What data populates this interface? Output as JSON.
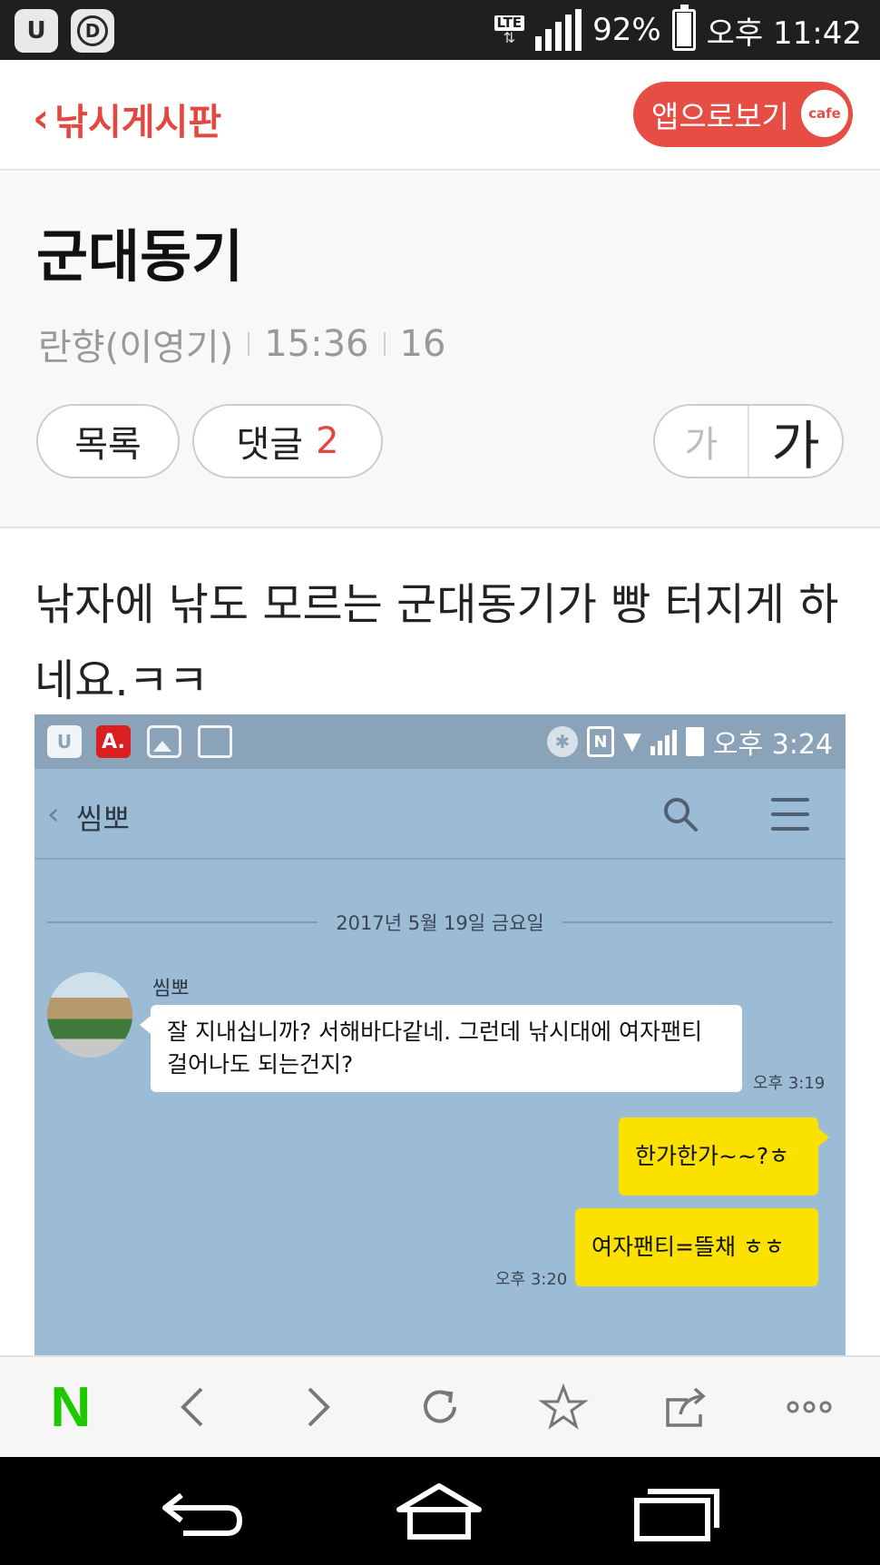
{
  "status_bar": {
    "app_icons": [
      "U",
      "D"
    ],
    "network": "LTE",
    "battery": "92%",
    "battery_level": 0.92,
    "time": "오후 11:42"
  },
  "cafe_header": {
    "back_label": "낚시게시판",
    "app_button": "앱으로보기",
    "cafe_badge": "cafe",
    "accent_color": "#e4473f"
  },
  "article": {
    "title": "군대동기",
    "author": "란향(이영기)",
    "time": "15:36",
    "views": "16",
    "list_button": "목록",
    "comment_label": "댓글",
    "comment_count": "2",
    "font_small": "가",
    "font_large": "가",
    "body_text": "낚자에 낚도 모르는 군대동기가 빵 터지게 하네요.ㅋㅋ"
  },
  "embedded_screenshot": {
    "status_bar": {
      "app_a_icon": "A.",
      "app_u_icon": "U",
      "nfc": "N",
      "time": "오후 3:24"
    },
    "chat_title": "씸뽀",
    "date_divider": "2017년 5월 19일 금요일",
    "messages": [
      {
        "sender": "씸뽀",
        "text": "잘 지내십니까? 서해바다같네. 그런데 낚시대에 여자팬티 걸어나도 되는건지?",
        "time": "오후 3:19"
      },
      {
        "text": "한가한가~~?ㅎ"
      },
      {
        "text": "여자팬티=뜰채 ㅎㅎ",
        "time": "오후 3:20"
      }
    ],
    "bubble_colors": {
      "incoming": "#ffffff",
      "outgoing": "#fae100",
      "background": "#9cbcd6"
    }
  },
  "toolbar": {
    "naver_label": "N",
    "icons": [
      "naver-icon",
      "back-arrow-icon",
      "forward-arrow-icon",
      "refresh-icon",
      "star-icon",
      "share-icon",
      "more-icon"
    ]
  },
  "nav_bar": {
    "icons": [
      "back-icon",
      "home-icon",
      "recent-apps-icon"
    ]
  }
}
